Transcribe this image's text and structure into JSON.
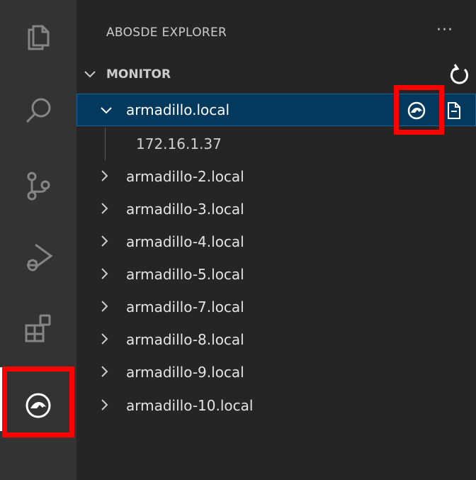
{
  "activity_bar": {
    "items": [
      {
        "icon": "files-icon"
      },
      {
        "icon": "search-icon"
      },
      {
        "icon": "source-control-icon"
      },
      {
        "icon": "run-debug-icon"
      },
      {
        "icon": "extensions-icon"
      },
      {
        "icon": "abosde-icon",
        "active": true
      }
    ]
  },
  "sidebar": {
    "title": "ABOSDE EXPLORER",
    "more_actions": "···",
    "section": {
      "title": "MONITOR",
      "refresh_icon": "refresh-icon",
      "devices": [
        {
          "label": "armadillo.local",
          "expanded": true,
          "selected": true,
          "children": [
            "172.16.1.37"
          ]
        },
        {
          "label": "armadillo-2.local"
        },
        {
          "label": "armadillo-3.local"
        },
        {
          "label": "armadillo-4.local"
        },
        {
          "label": "armadillo-5.local"
        },
        {
          "label": "armadillo-7.local"
        },
        {
          "label": "armadillo-8.local"
        },
        {
          "label": "armadillo-9.local"
        },
        {
          "label": "armadillo-10.local"
        }
      ]
    }
  },
  "colors": {
    "activity_bar_bg": "#333333",
    "sidebar_bg": "#252526",
    "selection_bg": "#04395e",
    "highlight": "#ff0000"
  }
}
